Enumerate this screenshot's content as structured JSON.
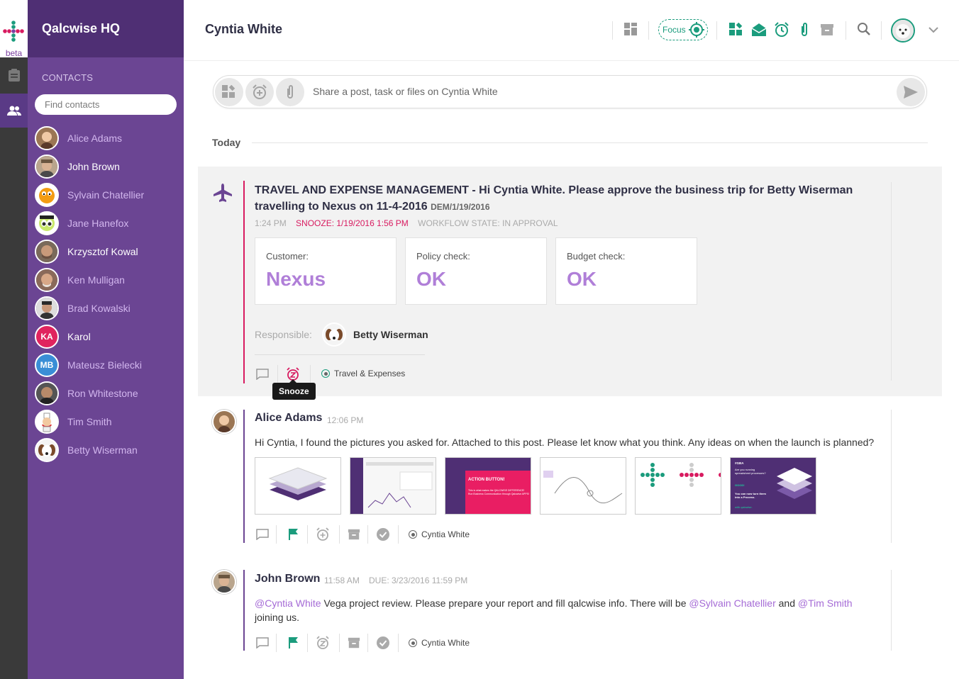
{
  "app": {
    "name": "Qalcwise HQ",
    "beta": "beta"
  },
  "sidebar": {
    "section_title": "CONTACTS",
    "search_placeholder": "Find contacts",
    "contacts": [
      {
        "name": "Alice Adams",
        "online": false,
        "initials": ""
      },
      {
        "name": "John Brown",
        "online": true,
        "initials": ""
      },
      {
        "name": "Sylvain Chatellier",
        "online": false,
        "initials": ""
      },
      {
        "name": "Jane Hanefox",
        "online": false,
        "initials": ""
      },
      {
        "name": "Krzysztof Kowal",
        "online": true,
        "initials": ""
      },
      {
        "name": "Ken Mulligan",
        "online": false,
        "initials": ""
      },
      {
        "name": "Brad Kowalski",
        "online": false,
        "initials": ""
      },
      {
        "name": "Karol",
        "online": true,
        "initials": "KA"
      },
      {
        "name": "Mateusz Bielecki",
        "online": false,
        "initials": "MB"
      },
      {
        "name": "Ron Whitestone",
        "online": false,
        "initials": ""
      },
      {
        "name": "Tim Smith",
        "online": false,
        "initials": ""
      },
      {
        "name": "Betty Wiserman",
        "online": false,
        "initials": ""
      }
    ]
  },
  "header": {
    "title": "Cyntia White",
    "focus_label": "Focus"
  },
  "composer": {
    "placeholder": "Share a post, task or files on Cyntia White"
  },
  "feed": {
    "day_label": "Today",
    "travel_post": {
      "title": "TRAVEL AND EXPENSE MANAGEMENT - Hi Cyntia White. Please approve the business trip for Betty Wiserman travelling to Nexus on 11-4-2016",
      "code": "DEM/1/19/2016",
      "time": "1:24 PM",
      "snooze": "SNOOZE: 1/19/2016 1:56 PM",
      "workflow": "WORKFLOW STATE: IN APPROVAL",
      "cards": [
        {
          "label": "Customer:",
          "value": "Nexus"
        },
        {
          "label": "Policy check:",
          "value": "OK"
        },
        {
          "label": "Budget check:",
          "value": "OK"
        }
      ],
      "responsible_label": "Responsible:",
      "responsible_name": "Betty Wiserman",
      "app_tag": "Travel & Expenses",
      "tooltip": "Snooze"
    },
    "alice_post": {
      "author": "Alice Adams",
      "time": "12:06 PM",
      "text": "Hi Cyntia, I found the pictures you asked for. Attached to this post. Please let know what you think. Any ideas on when the launch is planned?",
      "tag": "Cyntia White",
      "thumb3_title": "ACTION BUTTON!",
      "thumb3_text": "This is what makes the QALCWISE DIFFERENCE! Run Business Communication through Qalcwise APPS!",
      "thumb6_title": "#GBA",
      "thumb6_q": "Are you running spreadsheet processes?",
      "thumb6_good": "GOOD!",
      "thumb6_turn": "You can now turn them into a Process.",
      "thumb6_with": "with qalcwise."
    },
    "john_post": {
      "author": "John Brown",
      "time": "11:58 AM",
      "due": "DUE: 3/23/2016 11:59 PM",
      "mention1": "@Cyntia White",
      "text1": " Vega project review. Please prepare your report and fill qalcwise info. There will be ",
      "mention2": "@Sylvain Chatellier",
      "and": " and ",
      "mention3": "@Tim Smith",
      "text2": "joining us.",
      "tag": "Cyntia White"
    }
  },
  "colors": {
    "purple_dark": "#4f2f74",
    "purple": "#6b4593",
    "teal": "#1b9c7d",
    "accent_text": "#b07fd8",
    "snooze_red": "#d81b60"
  }
}
